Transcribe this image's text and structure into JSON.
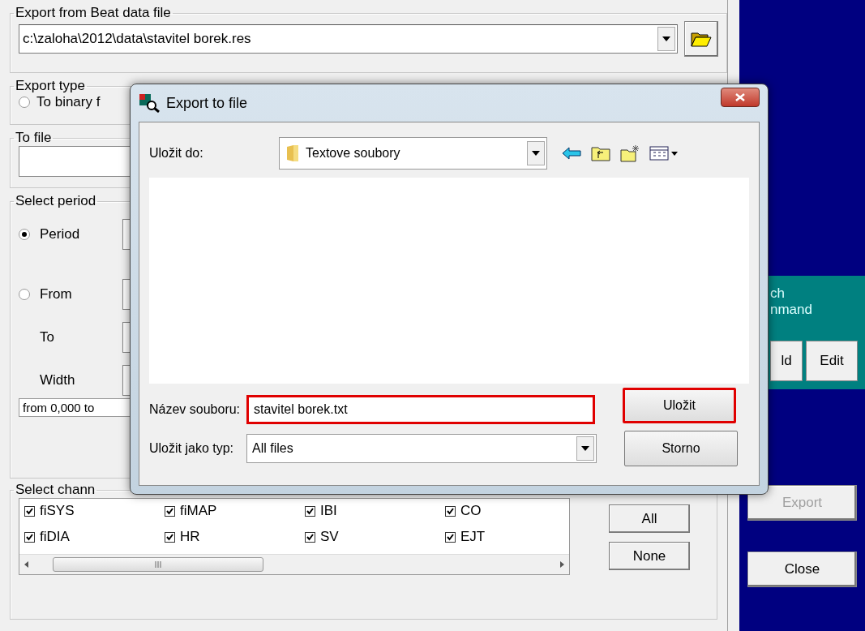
{
  "source": {
    "legend": "Export from Beat data file",
    "path": "c:\\zaloha\\2012\\data\\stavitel borek.res"
  },
  "export_type": {
    "legend": "Export type",
    "options": [
      {
        "label": "To binary f",
        "selected": false
      }
    ]
  },
  "to_file": {
    "legend": "To file"
  },
  "period": {
    "legend": "Select period",
    "rows": [
      {
        "kind": "radio",
        "label": "Period",
        "selected": true
      },
      {
        "kind": "radio",
        "label": "From",
        "selected": false
      },
      {
        "kind": "label",
        "label": "To"
      },
      {
        "kind": "label",
        "label": "Width"
      }
    ],
    "summary": "from 0,000 to"
  },
  "channels": {
    "legend": "Select chann",
    "items": [
      {
        "label": "fiSYS",
        "checked": true
      },
      {
        "label": "fiMAP",
        "checked": true
      },
      {
        "label": "IBI",
        "checked": true
      },
      {
        "label": "CO",
        "checked": true
      },
      {
        "label": "fiDIA",
        "checked": true
      },
      {
        "label": "HR",
        "checked": true
      },
      {
        "label": "SV",
        "checked": true
      },
      {
        "label": "EJT",
        "checked": true
      }
    ],
    "buttons": [
      "All",
      "None"
    ]
  },
  "command": {
    "lines": [
      "ch",
      "nmand"
    ],
    "buttons": [
      "ld",
      "Edit"
    ]
  },
  "actions": [
    {
      "label": "Export",
      "disabled": true
    },
    {
      "label": "Close",
      "disabled": false
    }
  ],
  "dialog": {
    "title": "Export to file",
    "save_in_label": "Uložit do:",
    "folder": "Textove soubory",
    "filename_label": "Název souboru:",
    "filename": "stavitel borek.txt",
    "filename_highlighted": true,
    "type_label": "Uložit jako typ:",
    "type": "All files",
    "buttons": [
      {
        "label": "Uložit",
        "highlighted": true
      },
      {
        "label": "Storno",
        "highlighted": false
      }
    ]
  }
}
